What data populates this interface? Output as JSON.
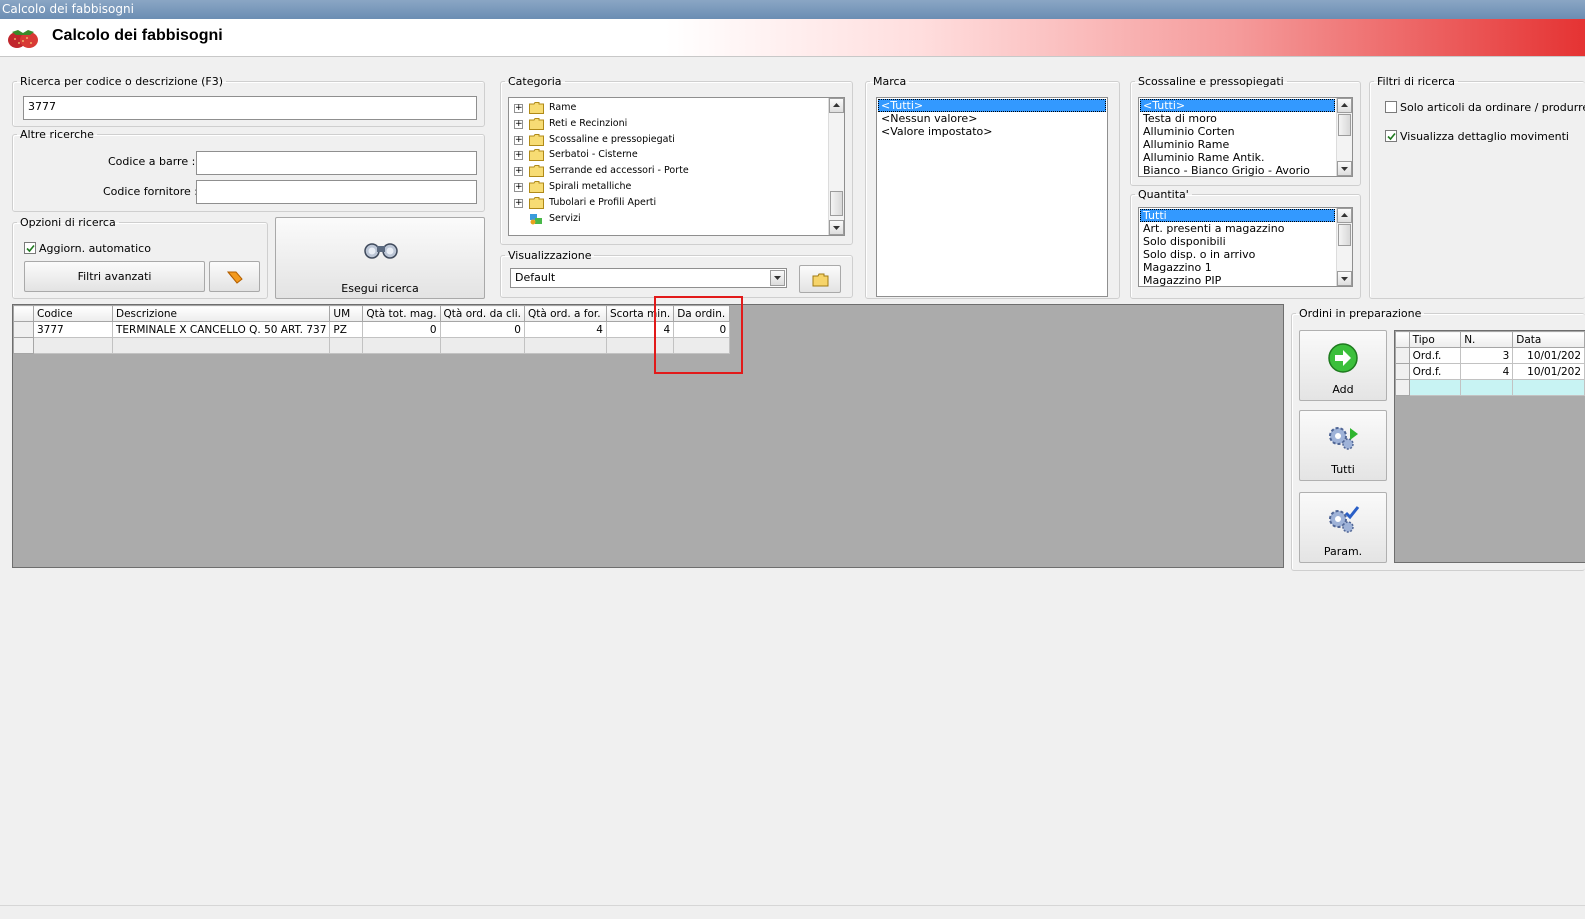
{
  "window": {
    "title": "Calcolo dei fabbisogni"
  },
  "header": {
    "title": "Calcolo dei fabbisogni"
  },
  "ricerca": {
    "legend": "Ricerca per codice o descrizione (F3)",
    "value": "3777"
  },
  "altre": {
    "legend": "Altre ricerche",
    "barcode_label": "Codice a barre :",
    "barcode_value": "",
    "supplier_label": "Codice fornitore :",
    "supplier_value": ""
  },
  "opzioni": {
    "legend": "Opzioni di ricerca",
    "auto_update_label": "Aggiorn. automatico",
    "auto_update_checked": true,
    "advanced_filters_label": "Filtri avanzati",
    "search_button_label": "Esegui ricerca"
  },
  "categoria": {
    "legend": "Categoria",
    "items": [
      {
        "label": "Rame",
        "icon": "folder-icon",
        "expandable": true
      },
      {
        "label": "Reti e Recinzioni",
        "icon": "folder-icon",
        "expandable": true
      },
      {
        "label": "Scossaline e pressopiegati",
        "icon": "folder-icon",
        "expandable": true
      },
      {
        "label": "Serbatoi - Cisterne",
        "icon": "folder-icon",
        "expandable": true
      },
      {
        "label": "Serrande ed accessori - Porte",
        "icon": "folder-icon",
        "expandable": true
      },
      {
        "label": "Spirali metalliche",
        "icon": "folder-icon",
        "expandable": true
      },
      {
        "label": "Tubolari e Profili Aperti",
        "icon": "folder-icon",
        "expandable": true
      },
      {
        "label": "Servizi",
        "icon": "services-icon",
        "expandable": false
      }
    ]
  },
  "visualizzazione": {
    "legend": "Visualizzazione",
    "selected": "Default"
  },
  "marca": {
    "legend": "Marca",
    "items": [
      "<Tutti>",
      "<Nessun valore>",
      "<Valore impostato>"
    ],
    "selected_index": 0
  },
  "scossaline": {
    "legend": "Scossaline e pressopiegati",
    "items": [
      "<Tutti>",
      "Testa di moro",
      "Alluminio Corten",
      "Alluminio Rame",
      "Alluminio Rame Antik.",
      "Bianco - Bianco Grigio - Avorio"
    ],
    "selected_index": 0
  },
  "quantita": {
    "legend": "Quantita'",
    "items": [
      "Tutti",
      "Art. presenti a magazzino",
      "Solo disponibili",
      "Solo disp. o in arrivo",
      "Magazzino 1",
      "Magazzino PIP"
    ],
    "selected_index": 0
  },
  "filtri": {
    "legend": "Filtri di ricerca",
    "only_to_order_label": "Solo articoli da ordinare / produrre",
    "only_to_order_checked": false,
    "show_details_label": "Visualizza dettaglio movimenti",
    "show_details_checked": true
  },
  "results": {
    "columns": [
      "Codice",
      "Descrizione",
      "UM",
      "Qtà tot. mag.",
      "Qtà ord. da cli.",
      "Qtà ord. a for.",
      "Scorta min.",
      "Da ordin."
    ],
    "rows": [
      [
        "3777",
        "TERMINALE X CANCELLO Q. 50 ART. 737",
        "PZ",
        "0",
        "0",
        "4",
        "4",
        "0"
      ]
    ]
  },
  "ordini": {
    "legend": "Ordini in preparazione",
    "add_label": "Add",
    "tutti_label": "Tutti",
    "param_label": "Param.",
    "columns": [
      "Tipo",
      "N.",
      "Data"
    ],
    "rows": [
      [
        "Ord.f.",
        "3",
        "10/01/202"
      ],
      [
        "Ord.f.",
        "4",
        "10/01/202"
      ]
    ]
  },
  "colors": {
    "selection": "#3399ff",
    "grid_background": "#ababab",
    "highlight_box": "#e21a1a",
    "header_gradient_end": "#e53333"
  }
}
